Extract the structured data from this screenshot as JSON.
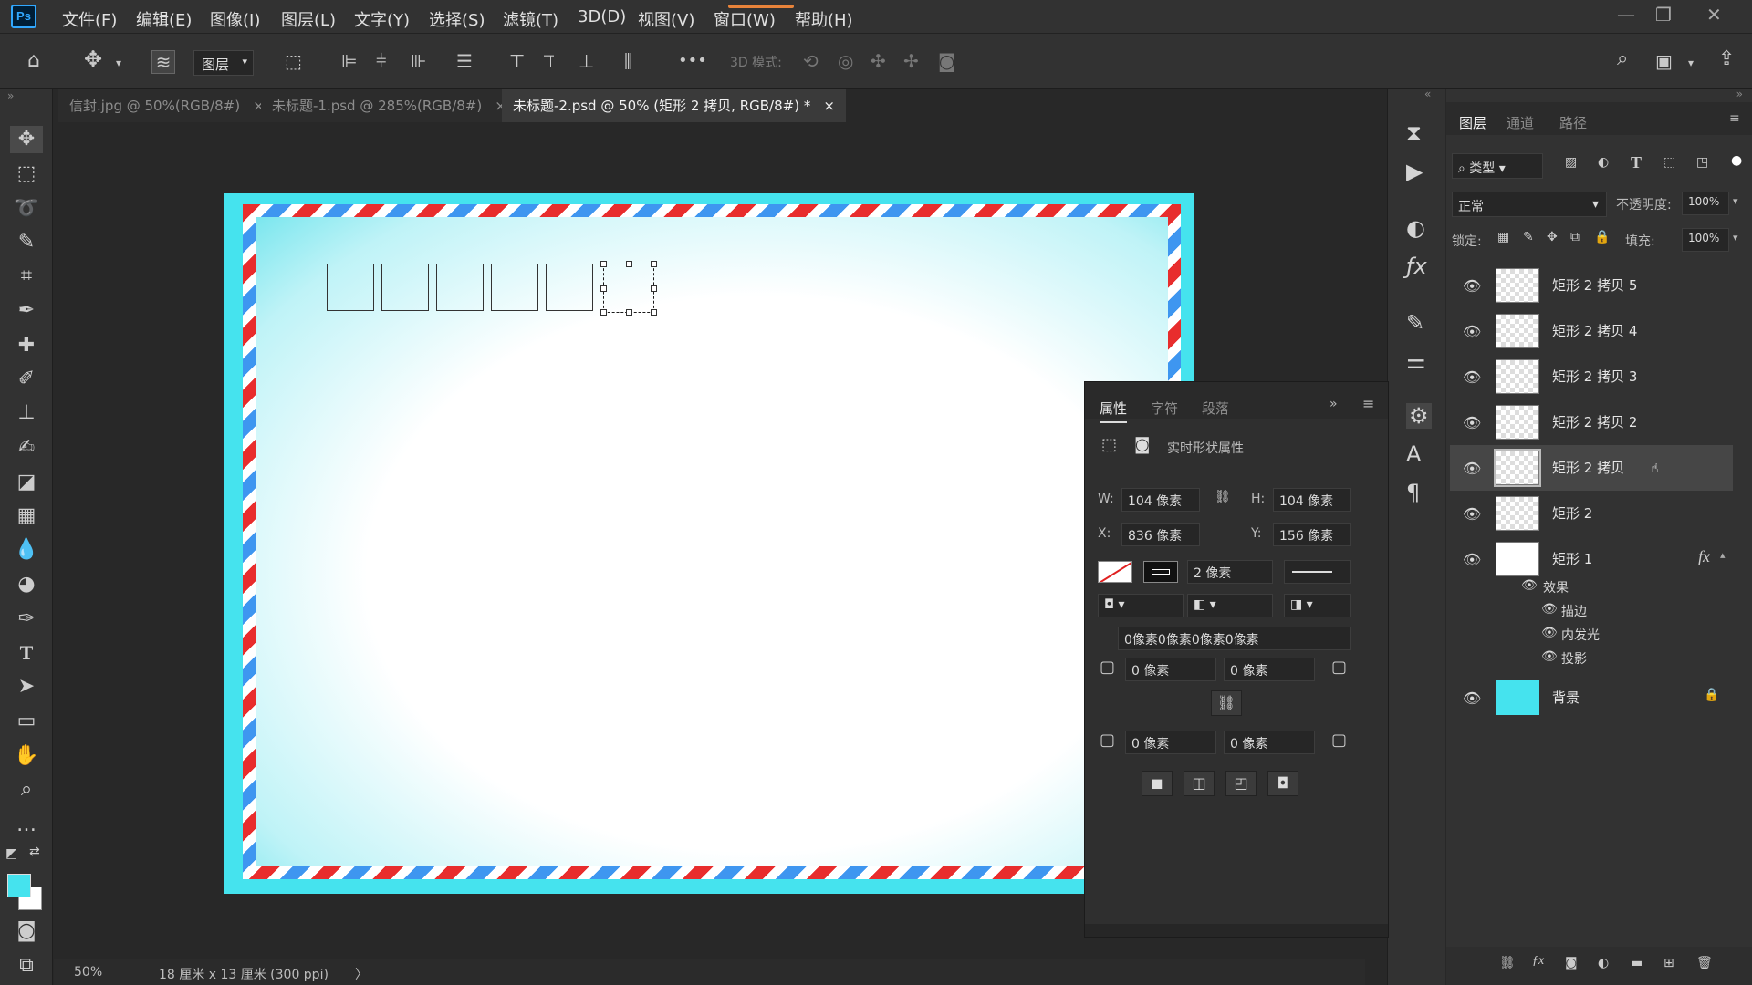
{
  "app": {
    "logo": "Ps"
  },
  "menu": [
    "文件(F)",
    "编辑(E)",
    "图像(I)",
    "图层(L)",
    "文字(Y)",
    "选择(S)",
    "滤镜(T)",
    "3D(D)",
    "视图(V)",
    "窗口(W)",
    "帮助(H)"
  ],
  "options": {
    "layer_select": "图层",
    "mode_3d": "3D 模式:",
    "more": "•••"
  },
  "tabs": [
    {
      "label": "信封.jpg @ 50%(RGB/8#)",
      "active": false
    },
    {
      "label": "未标题-1.psd @ 285%(RGB/8#)",
      "active": false
    },
    {
      "label": "未标题-2.psd @ 50% (矩形 2 拷贝, RGB/8#) *",
      "active": true
    }
  ],
  "close_glyph": "×",
  "status": {
    "zoom": "50%",
    "doc_info": "18 厘米 x 13 厘米 (300 ppi)",
    "arrow": "〉"
  },
  "colors": {
    "canvas_bg": "#45e3ee",
    "stripe_red": "#e82d2d",
    "stripe_blue": "#3e96f0",
    "foreground": "#45e3ee",
    "background": "#ffffff",
    "accent": "#31a8ff"
  },
  "properties": {
    "tabs": [
      "属性",
      "字符",
      "段落"
    ],
    "header": "实时形状属性",
    "w_label": "W:",
    "w": "104 像素",
    "h_label": "H:",
    "h": "104 像素",
    "x_label": "X:",
    "x": "836 像素",
    "y_label": "Y:",
    "y": "156 像素",
    "stroke_width": "2 像素",
    "corners_all": "0像素0像素0像素0像素",
    "r_tl": "0 像素",
    "r_tr": "0 像素",
    "r_bl": "0 像素",
    "r_br": "0 像素"
  },
  "layers_panel": {
    "tabs": [
      "图层",
      "通道",
      "路径"
    ],
    "filter": "类型",
    "blend": "正常",
    "opacity_label": "不透明度:",
    "opacity": "100%",
    "lock_label": "锁定:",
    "fill_label": "填充:",
    "fill": "100%",
    "layers": [
      {
        "name": "矩形 2 拷贝 5",
        "selected": false
      },
      {
        "name": "矩形 2 拷贝 4",
        "selected": false
      },
      {
        "name": "矩形 2 拷贝 3",
        "selected": false
      },
      {
        "name": "矩形 2 拷贝 2",
        "selected": false
      },
      {
        "name": "矩形 2 拷贝",
        "selected": true
      },
      {
        "name": "矩形 2",
        "selected": false
      },
      {
        "name": "矩形 1",
        "selected": false,
        "fx": "fx"
      }
    ],
    "effects_label": "效果",
    "effects": [
      "描边",
      "内发光",
      "投影"
    ],
    "background_layer": "背景"
  }
}
